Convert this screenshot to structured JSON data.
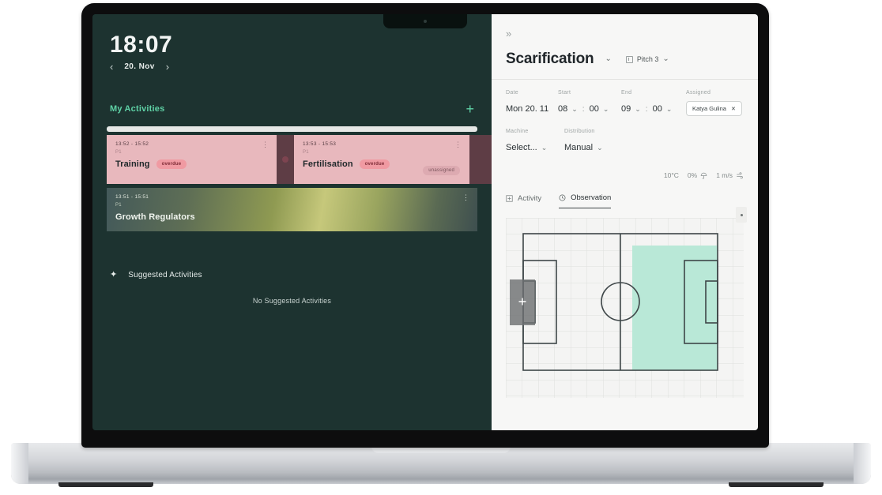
{
  "device": {
    "camera_icon": "camera-dot"
  },
  "left": {
    "clock": "18:07",
    "prev_icon": "‹",
    "next_icon": "›",
    "date": "20. Nov",
    "section_title": "My Activities",
    "add_icon": "+",
    "activities": [
      {
        "time": "13:52 - 15:52",
        "sub": "P1",
        "title": "Training",
        "badge": "overdue",
        "assignment": "",
        "menu_icon": "⋮"
      },
      {
        "time": "13:53 - 15:53",
        "sub": "P1",
        "title": "Fertilisation",
        "badge": "overdue",
        "assignment": "unassigned",
        "menu_icon": "⋮"
      },
      {
        "time": "13:51 - 15:51",
        "sub": "P1",
        "title": "Growth Regulators",
        "badge": "",
        "assignment": "",
        "menu_icon": "⋮"
      }
    ],
    "suggested": {
      "sparkle_icon": "✦",
      "title": "Suggested Activities",
      "empty_text": "No Suggested Activities"
    }
  },
  "right": {
    "collapse_icon": "»",
    "title": "Scarification",
    "title_chevron": "⌄",
    "pitch": {
      "label": "Pitch 3",
      "chevron": "⌄",
      "icon": "pitch-icon"
    },
    "fields": {
      "date": {
        "label": "Date",
        "value": "Mon 20. 11"
      },
      "start": {
        "label": "Start",
        "hour": "08",
        "minute": "00",
        "separator": ":"
      },
      "end": {
        "label": "End",
        "hour": "09",
        "minute": "00",
        "separator": ":"
      },
      "assigned": {
        "label": "Assigned",
        "person": "Katya Gulina",
        "remove_icon": "✕"
      },
      "machine": {
        "label": "Machine",
        "value": "Select..."
      },
      "distribution": {
        "label": "Distribution",
        "value": "Manual"
      }
    },
    "weather": {
      "temperature": "10°C",
      "precipitation": "0%",
      "precip_icon": "umbrella-icon",
      "wind": "1 m/s",
      "wind_icon": "wind-icon"
    },
    "tabs": [
      {
        "label": "Activity",
        "icon": "plus-box-icon",
        "active": false
      },
      {
        "label": "Observation",
        "icon": "clock-icon",
        "active": true
      }
    ],
    "diagram": {
      "zoom_icon": "zoom-dot-icon",
      "selection_handle_icon": "+",
      "colors": {
        "highlight": "#b8e8d6",
        "selection": "#6f7273",
        "line": "#3e4648",
        "grid": "#dcdedd"
      }
    }
  }
}
